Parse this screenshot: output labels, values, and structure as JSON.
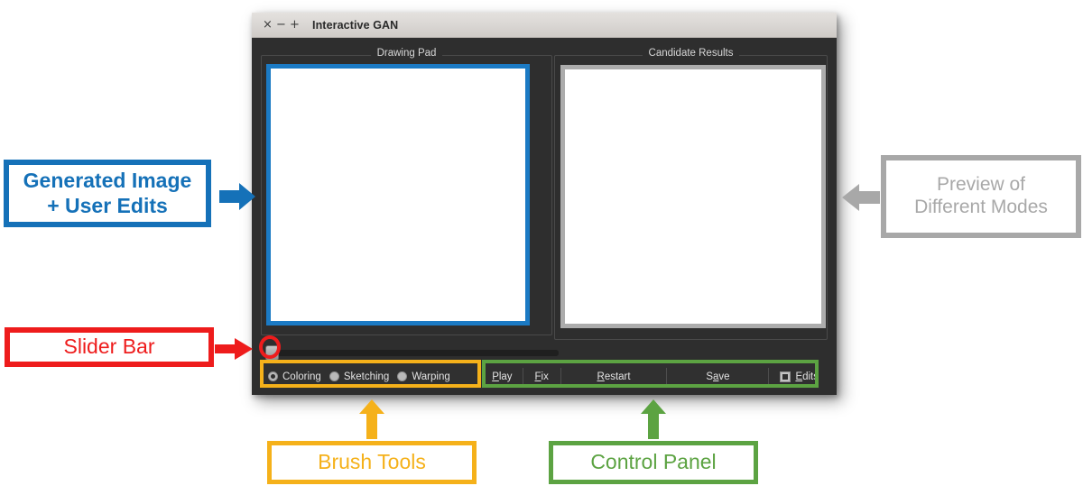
{
  "window": {
    "title": "Interactive GAN",
    "controls": [
      {
        "name": "close",
        "glyph": "×"
      },
      {
        "name": "minimize",
        "glyph": "−"
      },
      {
        "name": "maximize",
        "glyph": "+"
      }
    ]
  },
  "panels": {
    "drawing_pad": {
      "title": "Drawing Pad",
      "border_color": "#1b7ac4",
      "canvas_color": "#ffffff"
    },
    "candidate_results": {
      "title": "Candidate Results",
      "border_color": "#acacac",
      "canvas_color": "#ffffff"
    }
  },
  "slider": {
    "value": 0,
    "handle_position": "left"
  },
  "brush_tools": {
    "options": [
      {
        "label": "Coloring",
        "selected": true
      },
      {
        "label": "Sketching",
        "selected": false
      },
      {
        "label": "Warping",
        "selected": false
      }
    ]
  },
  "control_panel": {
    "buttons": [
      {
        "label": "Play",
        "mnemonic": "P",
        "rest": "lay"
      },
      {
        "label": "Fix",
        "mnemonic": "F",
        "rest": "ix"
      },
      {
        "label": "Restart",
        "mnemonic": "R",
        "rest": "estart"
      },
      {
        "label": "Save",
        "pre": "S",
        "mnemonic": "a",
        "rest": "ve"
      }
    ],
    "checkbox": {
      "pre": "",
      "mnemonic": "E",
      "rest": "dits",
      "label": "Edits",
      "checked": true
    }
  },
  "annotations": {
    "generated_image": {
      "line1": "Generated Image",
      "line2": "+ User Edits",
      "color": "#1571b8"
    },
    "preview_modes": {
      "line1": "Preview of",
      "line2": "Different Modes",
      "color": "#a8a8a8"
    },
    "slider_bar": {
      "line1": "Slider Bar",
      "color": "#ee1c1c"
    },
    "brush_tools": {
      "line1": "Brush Tools",
      "color": "#f5b11a"
    },
    "control_panel": {
      "line1": "Control Panel",
      "color": "#5ca342"
    }
  }
}
